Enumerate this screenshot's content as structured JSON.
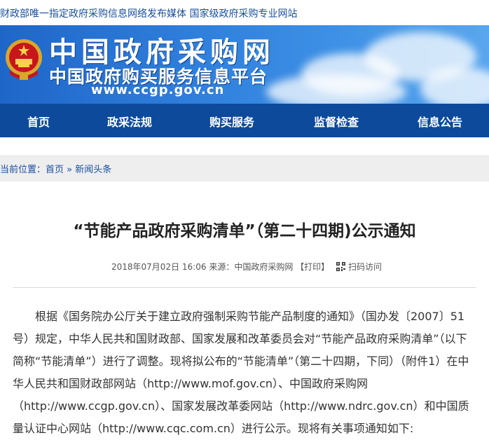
{
  "topbar": {
    "text": "财政部唯一指定政府采购信息网络发布媒体 国家级政府采购专业网站"
  },
  "banner": {
    "title_cn": "中国政府采购网",
    "subtitle_cn": "中国政府购买服务信息平台",
    "url": "www.ccgp.gov.cn"
  },
  "nav": [
    "首页",
    "政采法规",
    "购买服务",
    "监督检查",
    "信息公告"
  ],
  "breadcrumb": {
    "prefix": "当前位置：",
    "home": "首页",
    "sep": " » ",
    "current": "新闻头条"
  },
  "article": {
    "title": "“节能产品政府采购清单”（第二十四期)公示通知",
    "date": "2018年07月02日 16:06",
    "source_label": "来源：",
    "source": "中国政府采购网",
    "print": "【打印】",
    "qr_label": "扫码访问",
    "body": "根据《国务院办公厅关于建立政府强制采购节能产品制度的通知》（国办发〔2007〕51号）规定，中华人民共和国财政部、国家发展和改革委员会对“节能产品政府采购清单”（以下简称“节能清单”）进行了调整。现将拟公布的“节能清单”（第二十四期，下同）（附件1）在中华人民共和国财政部网站（http://www.mof.gov.cn）、中国政府采购网（http://www.ccgp.gov.cn）、国家发展改革委网站（http://www.ndrc.gov.cn）和中国质量认证中心网站（http://www.cqc.com.cn）进行公示。现将有关事项通知如下:"
  },
  "colors": {
    "nav_bg": "#0d4a9b",
    "link": "#1a4f9e",
    "banner": "#2f7fdc"
  }
}
